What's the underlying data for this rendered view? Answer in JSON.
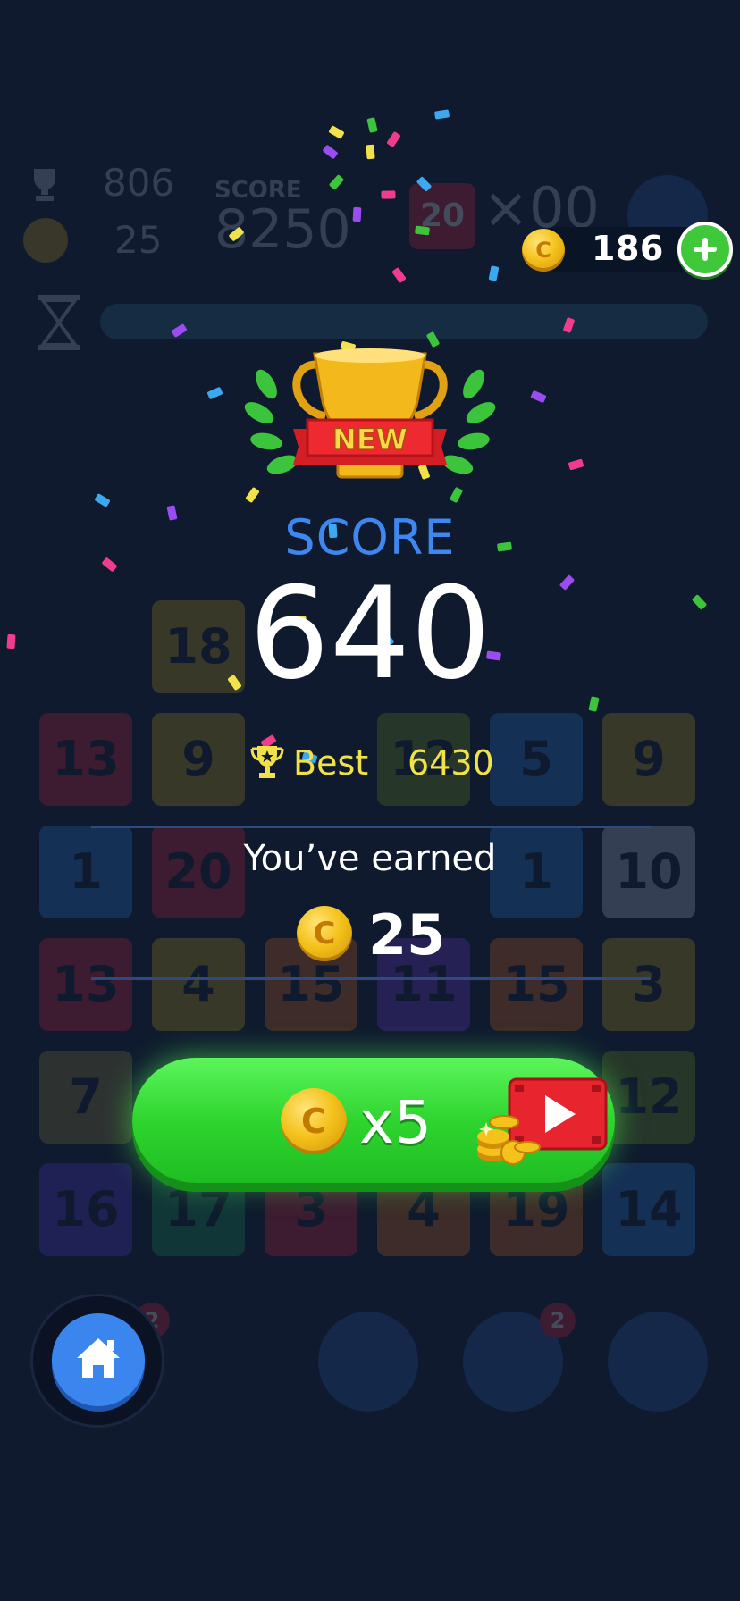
{
  "background_game": {
    "best": "806",
    "coins": "25",
    "score_label": "SCORE",
    "score": "8250",
    "target_tile": "20",
    "multiplier": "×00",
    "tiles": [
      {
        "v": "18",
        "c": "#c8a41a"
      },
      {
        "v": "13",
        "c": "#e0213e"
      },
      {
        "v": "9",
        "c": "#c8a41a"
      },
      {
        "v": "12",
        "c": "#7a9a1c"
      },
      {
        "v": "5",
        "c": "#2a7de0"
      },
      {
        "v": "9",
        "c": "#c8a41a"
      },
      {
        "v": "1",
        "c": "#2a7de0"
      },
      {
        "v": "20",
        "c": "#e0213e"
      },
      {
        "v": "1",
        "c": "#2a7de0"
      },
      {
        "v": "10",
        "c": "#b8c4d8"
      },
      {
        "v": "13",
        "c": "#e0213e"
      },
      {
        "v": "4",
        "c": "#c8a41a"
      },
      {
        "v": "15",
        "c": "#e06c1a"
      },
      {
        "v": "11",
        "c": "#7a3ce0"
      },
      {
        "v": "15",
        "c": "#e06c1a"
      },
      {
        "v": "3",
        "c": "#c8a41a"
      },
      {
        "v": "7",
        "c": "#9a8a3c"
      },
      {
        "v": "12",
        "c": "#7a9a1c"
      },
      {
        "v": "16",
        "c": "#5a3ce0"
      },
      {
        "v": "17",
        "c": "#1c9a5a"
      },
      {
        "v": "3",
        "c": "#e0213e"
      },
      {
        "v": "4",
        "c": "#e06c1a"
      },
      {
        "v": "19",
        "c": "#e06c1a"
      },
      {
        "v": "14",
        "c": "#2a7de0"
      }
    ],
    "badges": [
      "2",
      "2"
    ]
  },
  "coin_balance": "186",
  "modal": {
    "new_badge": "NEW",
    "score_label": "SCORE",
    "score_value": "640",
    "best_label": "Best",
    "best_value": "6430",
    "earned_label": "You’ve earned",
    "earned_value": "25",
    "reward_multiplier": "x5"
  },
  "colors": {
    "background": "#0f1a2e",
    "score_label": "#3f87f0",
    "best_text": "#f2e24a",
    "reward_button": "#2fd52f",
    "home_button": "#3b86ee",
    "video_red": "#e8242e"
  },
  "icons": [
    "trophy-icon",
    "coin-icon",
    "plus-icon",
    "play-video-icon",
    "home-icon",
    "hourglass-icon",
    "pause-icon"
  ]
}
